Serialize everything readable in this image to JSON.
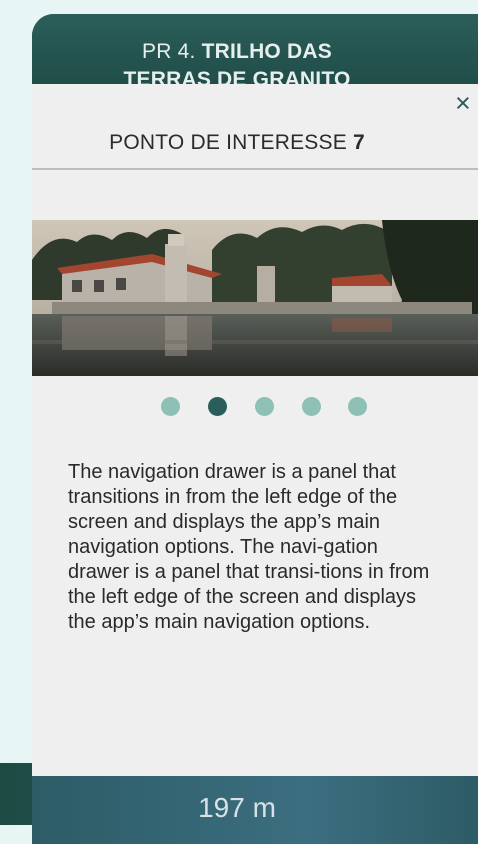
{
  "header": {
    "title_prefix": "PR 4. ",
    "title_bold": "TRILHO DAS",
    "title_line2": "TERRAS DE GRANITO"
  },
  "modal": {
    "close_glyph": "×",
    "poi_prefix": "PONTO DE INTERESSE ",
    "poi_number": "7",
    "carousel": {
      "count": 5,
      "active_index": 1
    },
    "description": "The navigation drawer is a panel that transitions in from the left edge of the screen and displays the app’s main navigation options. The navi-gation drawer is a panel that transi-tions in from the left edge of the screen and displays the app’s main navigation options."
  },
  "footer": {
    "distance": "197 m"
  },
  "colors": {
    "accent": "#2b5e5a",
    "dot_inactive": "#8fc0b6",
    "background": "#e7f6f5"
  }
}
